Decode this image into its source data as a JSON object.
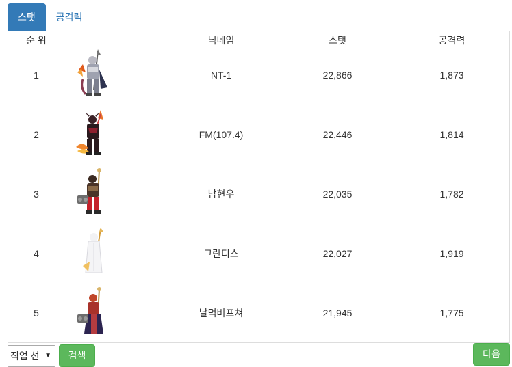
{
  "tabs": [
    {
      "label": "스탯",
      "active": true
    },
    {
      "label": "공격력",
      "active": false
    }
  ],
  "table": {
    "headers": {
      "rank": "순 위",
      "nickname": "닉네임",
      "stat": "스탯",
      "attack": "공격력"
    },
    "rows": [
      {
        "rank": "1",
        "avatar": "character-armored-knight",
        "nickname": "NT-1",
        "stat": "22,866",
        "attack": "1,873"
      },
      {
        "rank": "2",
        "avatar": "character-dark-demon",
        "nickname": "FM(107.4)",
        "stat": "22,446",
        "attack": "1,814"
      },
      {
        "rank": "3",
        "avatar": "character-red-warrior",
        "nickname": "남현우",
        "stat": "22,035",
        "attack": "1,782"
      },
      {
        "rank": "4",
        "avatar": "character-white-mage",
        "nickname": "그란디스",
        "stat": "22,027",
        "attack": "1,919"
      },
      {
        "rank": "5",
        "avatar": "character-robed-warrior",
        "nickname": "날먹버프쳐",
        "stat": "21,945",
        "attack": "1,775"
      }
    ]
  },
  "footer": {
    "job_select_value": "직업 선",
    "search_label": "검색",
    "next_label": "다음"
  },
  "colors": {
    "tab_active": "#337ab7",
    "button_green": "#5cb85c",
    "border": "#dddddd"
  }
}
